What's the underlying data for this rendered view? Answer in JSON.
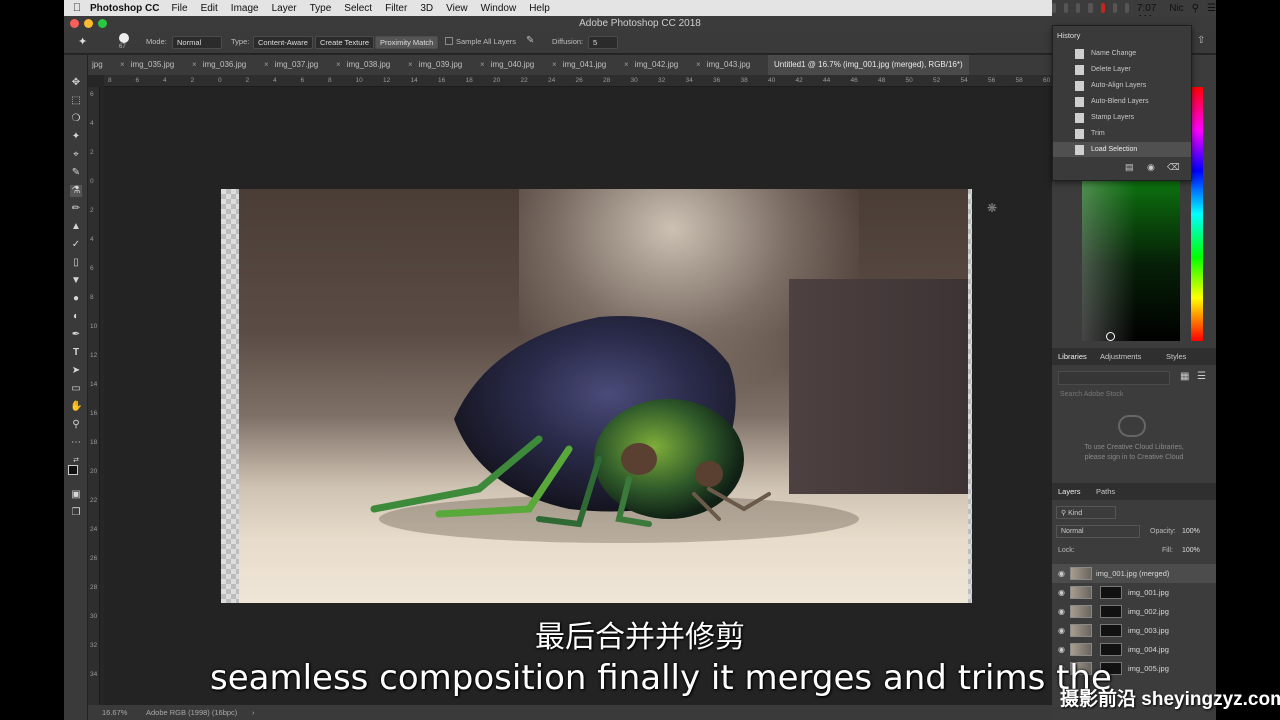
{
  "menubar": {
    "app_name": "Photoshop CC",
    "items": [
      "File",
      "Edit",
      "Image",
      "Layer",
      "Type",
      "Select",
      "Filter",
      "3D",
      "View",
      "Window",
      "Help"
    ],
    "clock": "Mon 7:07 AM",
    "user": "Nic"
  },
  "window": {
    "title": "Adobe Photoshop CC 2018"
  },
  "options": {
    "brush_size": "67",
    "mode_label": "Mode:",
    "mode_value": "Normal",
    "type_label": "Type:",
    "type_options": [
      "Content-Aware",
      "Create Texture",
      "Proximity Match"
    ],
    "sample_all_layers": "Sample All Layers",
    "diffusion_label": "Diffusion:",
    "diffusion_value": "5"
  },
  "tabs": [
    "jpg",
    "img_035.jpg",
    "img_036.jpg",
    "img_037.jpg",
    "img_038.jpg",
    "img_039.jpg",
    "img_040.jpg",
    "img_041.jpg",
    "img_042.jpg",
    "img_043.jpg",
    "Untitled1 @ 16.7% (img_001.jpg (merged), RGB/16*)"
  ],
  "ruler_h": [
    "8",
    "6",
    "4",
    "2",
    "0",
    "2",
    "4",
    "6",
    "8",
    "10",
    "12",
    "14",
    "16",
    "18",
    "20",
    "22",
    "24",
    "26",
    "28",
    "30",
    "32",
    "34",
    "36",
    "38",
    "40",
    "42",
    "44",
    "46",
    "48",
    "50",
    "52",
    "54",
    "56",
    "58",
    "60",
    "62"
  ],
  "ruler_v": [
    "6",
    "4",
    "2",
    "0",
    "2",
    "4",
    "6",
    "8",
    "10",
    "12",
    "14",
    "16",
    "18",
    "20",
    "22",
    "24",
    "26",
    "28",
    "30",
    "32",
    "34"
  ],
  "history": {
    "title": "History",
    "items": [
      "Name Change",
      "Delete Layer",
      "Auto-Align Layers",
      "Auto-Blend Layers",
      "Stamp Layers",
      "Trim",
      "Load Selection"
    ]
  },
  "libraries": {
    "tabs": [
      "Libraries",
      "Adjustments",
      "Styles"
    ],
    "search_placeholder": "Search Adobe Stock",
    "message_line1": "To use Creative Cloud Libraries,",
    "message_line2": "please sign in to Creative Cloud"
  },
  "layers": {
    "tabs": [
      "Layers",
      "Paths"
    ],
    "kind": "Kind",
    "blend_mode": "Normal",
    "opacity_label": "Opacity:",
    "opacity_value": "100%",
    "lock_label": "Lock:",
    "fill_label": "Fill:",
    "fill_value": "100%",
    "rows": [
      "img_001.jpg (merged)",
      "img_001.jpg",
      "img_002.jpg",
      "img_003.jpg",
      "img_004.jpg",
      "img_005.jpg"
    ]
  },
  "status": {
    "zoom": "16.67%",
    "profile": "Adobe RGB (1998) (16bpc)"
  },
  "subtitles": {
    "chinese": "最后合并并修剪",
    "english": "seamless composition finally it merges and trims the"
  },
  "watermark": "摄影前沿 sheyingzyz.com",
  "colors": {
    "accent_green": "#19e31d",
    "background": "#262626"
  }
}
